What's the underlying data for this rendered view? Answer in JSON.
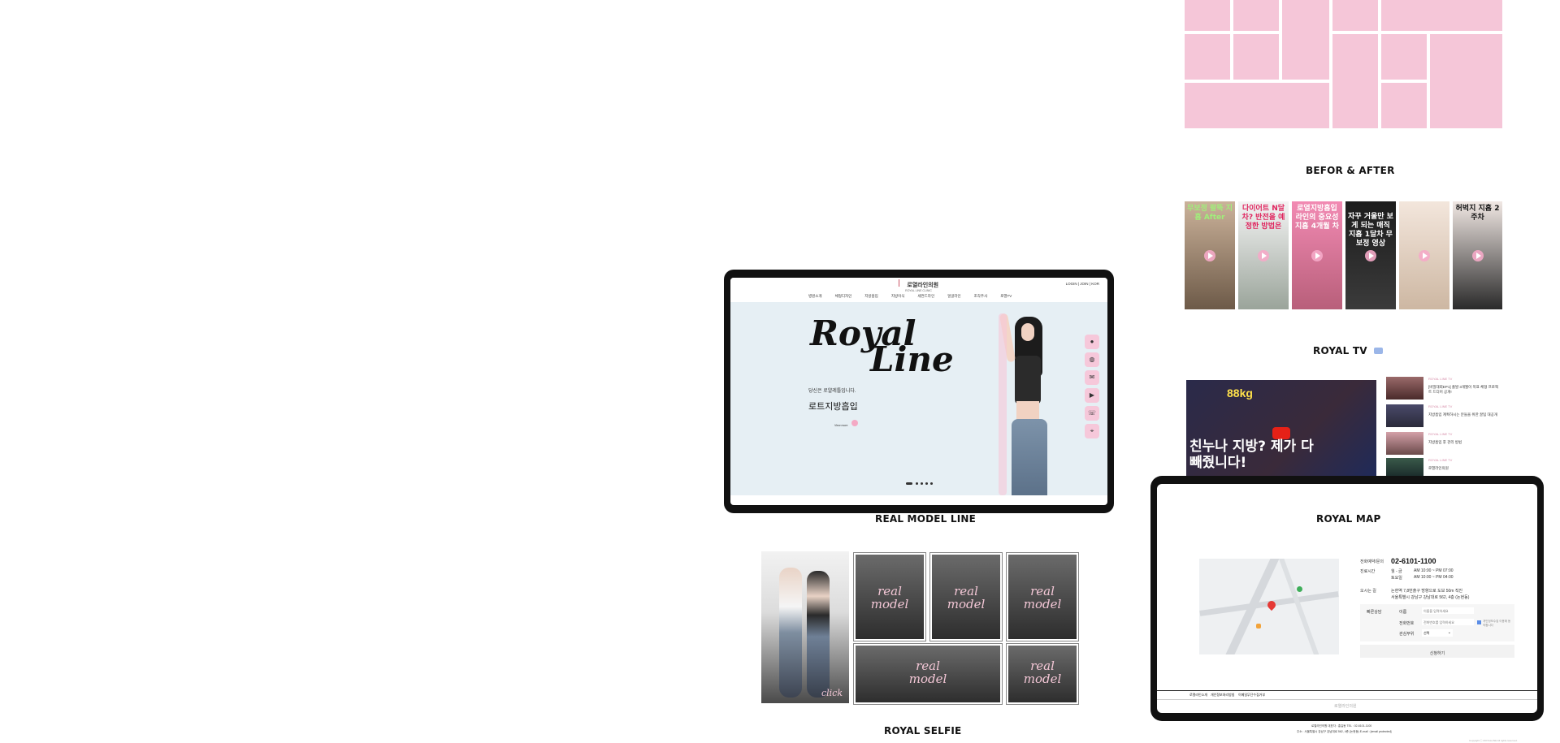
{
  "sections": {
    "before_after": "BEFOR & AFTER",
    "royal_tv": "ROYAL TV",
    "real_model_line": "REAL MODEL LINE",
    "royal_selfie": "ROYAL SELFIE",
    "royal_map": "ROYAL MAP"
  },
  "hero": {
    "logo_name": "로열라인의원",
    "logo_sub": "ROYAL LINE CLINIC",
    "top_links": [
      "LOGIN",
      "JOIN",
      "KOR"
    ],
    "menu": [
      "병원소개",
      "체형디자인",
      "지방흡입",
      "지방이식",
      "세컨드라인",
      "얼굴라인",
      "조각주사",
      "로열TV"
    ],
    "title_line1": "Royal",
    "title_line2": "Line",
    "tagline": "당신은 로얄레틀입니다.",
    "subtitle": "로트지방흡입",
    "more_btn": "View more"
  },
  "before_after_thumbs": [
    {
      "text": "무보정 팔뚝 지흡 After"
    },
    {
      "text": "다이어트 N달차? 반전을 예정한 방법은"
    },
    {
      "text": "로열지방흡입 라인의 중요성 지흡 4개월 차"
    },
    {
      "text": "자꾸 거울만 보게 되는 매직 지흡 1달차 무보정 영상"
    },
    {
      "text": ""
    },
    {
      "text": "허벅지 지흡 2주차"
    }
  ],
  "tv": {
    "main_text": "친누나 지방? 제가 다 빼줬니다!",
    "main_badge": "88kg",
    "list": [
      {
        "date": "ROYAL LINE TV",
        "title": "[비밀대회EP1] 출발 3개월이 목표 체형 프로젝트 드디어 공개!"
      },
      {
        "date": "ROYAL LINE TV",
        "title": "지방흡입 계획하시는 분들을 위한 꿀팁 대공개"
      },
      {
        "date": "ROYAL LINE TV",
        "title": "지방흡입 후 관리 방법"
      },
      {
        "date": "ROYAL LINE TV",
        "title": "로열라인의원"
      }
    ]
  },
  "models": {
    "word1": "real",
    "word2": "model",
    "click": "click"
  },
  "map": {
    "phone_label": "전화예약/문의",
    "phone": "02-6101-1100",
    "hours": [
      {
        "label": "진료시간",
        "days": "월 - 금",
        "time": "AM 10:00 ~ PM 07:00"
      },
      {
        "label": "",
        "days": "토요일",
        "time": "AM 10:00 ~ PM 04:00"
      }
    ],
    "addr_label": "오시는 길",
    "addr1": "논현역 7,8번출구 방향으로 도보 50m 직진",
    "addr2": "서울특별시 강남구 강남대로 562, 4층 (논현동)",
    "form_label": "빠른상담",
    "name_label": "이름",
    "name_ph": "이름을 입력하세요",
    "phone_field_label": "전화번호",
    "phone_ph": "전화번호를 입력하세요",
    "part_label": "관심부위",
    "part_value": "선택",
    "agree": "개인정보수집 이용에 동의합니다",
    "submit": "신청하기",
    "footer_links": [
      "로열라인소개",
      "개인정보처리방침",
      "이메일무단수집거부"
    ],
    "footer_logo": "로열라인의원",
    "footer_info1": "로열라인의원  대표자 : 홍길동   TEL : 02-6101-1100",
    "footer_info2": "주소 : 서울특별시 강남구 강남대로 562, 4층 (논현동)   E-mail : [email protected]",
    "copyright": "Copyright ⓒ ROYALLINE All rights reserved."
  },
  "icons": {
    "side": [
      "kakao-icon",
      "chat-icon",
      "message-icon",
      "youtube-icon",
      "call-icon",
      "map-pin-icon",
      "person-icon"
    ]
  }
}
